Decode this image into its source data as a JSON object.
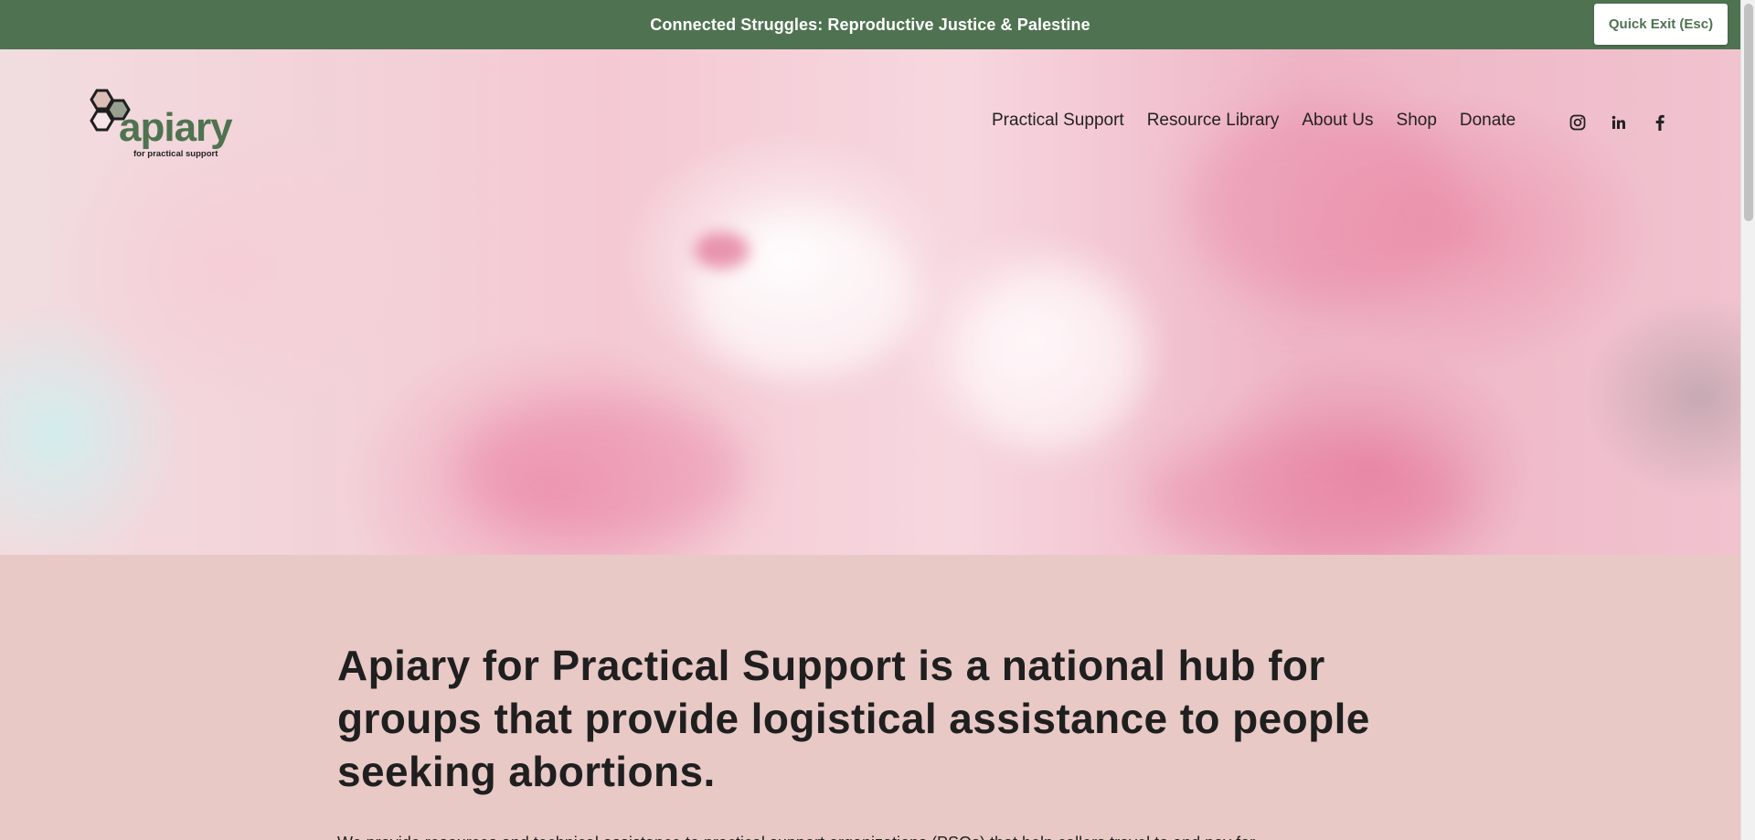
{
  "announcement": {
    "text": "Connected Struggles: Reproductive Justice & Palestine",
    "quick_exit_label": "Quick Exit (Esc)"
  },
  "brand": {
    "logo_word": "apiary",
    "logo_tagline": "for practical support",
    "color": "#4f7350"
  },
  "nav": {
    "items": [
      "Practical Support",
      "Resource Library",
      "About Us",
      "Shop",
      "Donate"
    ]
  },
  "social": {
    "icons": [
      "instagram-icon",
      "linkedin-icon",
      "facebook-icon"
    ]
  },
  "main": {
    "headline": "Apiary for Practical Support is a national hub for groups that provide logistical assistance to people seeking abortions.",
    "body": "We provide resources and technical assistance to practical support organizations (PSOs) that help callers travel to and pay for"
  },
  "colors": {
    "announcement_bg": "#4f7350",
    "content_bg": "#e8c9c6"
  }
}
